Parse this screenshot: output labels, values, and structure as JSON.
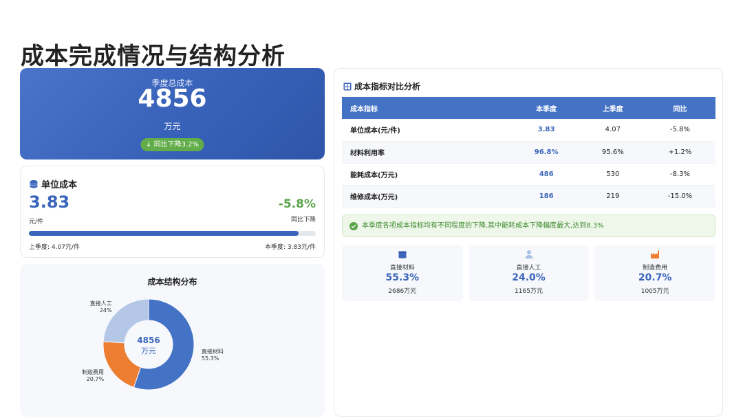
{
  "page": {
    "title": "成本完成情况与结构分析"
  },
  "colors": {
    "accent": "#4472c4",
    "green": "#5aa34a",
    "orange": "#ed7d31",
    "light_blue": "#b4c7e7"
  },
  "hero": {
    "label": "季度总成本",
    "value": "4856",
    "unit": "万元",
    "badge": "同比下降3.2%"
  },
  "unit_cost": {
    "title": "单位成本",
    "value": "3.83",
    "unit": "元/件",
    "change": "-5.8%",
    "change_label": "同比下降",
    "progress_fraction": 0.94,
    "last_quarter": "上季度: 4.07元/件",
    "this_quarter": "本季度: 3.83元/件"
  },
  "structure": {
    "title": "成本结构分布",
    "center_value": "4856",
    "center_unit": "万元"
  },
  "chart_data": {
    "type": "pie",
    "title": "成本结构分布",
    "categories": [
      "直接材料",
      "直接人工",
      "制造费用"
    ],
    "values": [
      55.3,
      24.0,
      20.7
    ],
    "labels": [
      "55.3%",
      "24%",
      "20.7%"
    ],
    "colors": [
      "#4472c4",
      "#b4c7e7",
      "#ed7d31"
    ]
  },
  "comparison": {
    "title": "成本指标对比分析",
    "headers": [
      "成本指标",
      "本季度",
      "上季度",
      "同比"
    ],
    "rows": [
      [
        "单位成本(元/件)",
        "3.83",
        "4.07",
        "-5.8%"
      ],
      [
        "材料利用率",
        "96.8%",
        "95.6%",
        "+1.2%"
      ],
      [
        "能耗成本(万元)",
        "486",
        "530",
        "-8.3%"
      ],
      [
        "维修成本(万元)",
        "186",
        "219",
        "-15.0%"
      ]
    ]
  },
  "notice": "本季度各项成本指标均有不同程度的下降,其中能耗成本下降幅度最大,达到8.3%",
  "tiles": [
    {
      "name": "直接材料",
      "pct": "55.3%",
      "amount": "2686万元",
      "icon": "box-icon"
    },
    {
      "name": "直接人工",
      "pct": "24.0%",
      "amount": "1165万元",
      "icon": "person-icon"
    },
    {
      "name": "制造费用",
      "pct": "20.7%",
      "amount": "1005万元",
      "icon": "factory-icon"
    }
  ]
}
